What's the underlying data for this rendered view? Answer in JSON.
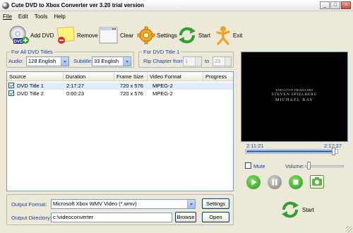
{
  "window": {
    "title": "Cute DVD to Xbox Converter ver 3.20  trial version"
  },
  "menu": [
    "File",
    "Edit",
    "Tools",
    "Help"
  ],
  "toolbar": {
    "add_dvd": "Add DVD",
    "remove": "Remove",
    "clear": "Clear",
    "settings": "Settings",
    "start": "Start",
    "exit": "Exit"
  },
  "all_titles": {
    "legend": "For All DVD Titles",
    "audio_label": "Audio:",
    "audio_value": "128  English",
    "subtitle_label": "Subtitle:",
    "subtitle_value": "33  English"
  },
  "title1": {
    "legend": "For DVD Title 1",
    "rip_label": "Rip Chapter from:",
    "from_value": "1",
    "to_label": "to",
    "to_value": "23"
  },
  "list": {
    "columns": [
      "Source",
      "Duration",
      "Frame Size",
      "Video Format",
      "Progress"
    ],
    "rows": [
      {
        "source": "DVD Title 1",
        "duration": "2:17:27",
        "frame_size": "720 x 576",
        "video_format": "MPEG-2",
        "progress": ""
      },
      {
        "source": "DVD Title 2",
        "duration": "0:00:23",
        "frame_size": "720 x 576",
        "video_format": "MPEG-2",
        "progress": ""
      }
    ]
  },
  "output": {
    "format_label": "Output Format:",
    "format_value": "Microsoft Xbox WMV Video (*.wmv)",
    "settings_button": "Settings",
    "dir_label": "Output Directory:",
    "dir_value": "c:\\videoconverter",
    "browse_button": "Browse",
    "open_button": "Open"
  },
  "preview": {
    "credit_line1": "EXECUTIVE PRODUCERS",
    "credit_line2": "STEVEN SPIELBERG",
    "credit_line3": "MICHAEL BAY",
    "time_current": "2:11:21",
    "time_total": "2:17:27",
    "position_fraction": 0.955,
    "mute_label": "Mute",
    "volume_label": "Volume:",
    "volume_fraction": 0.05
  },
  "big_start": {
    "label": "Start"
  },
  "colors": {
    "label_blue": "#1a3fa8",
    "selection": "#e2ecfa",
    "progress_blue": "#3c6fd6"
  }
}
